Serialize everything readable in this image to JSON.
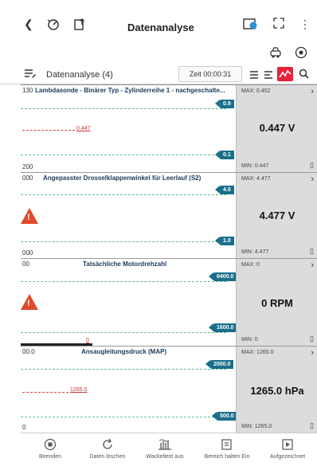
{
  "header": {
    "title": "Datenanalyse",
    "back_icon": "chevron-left-icon",
    "left_icons": [
      "gauge-icon",
      "clipboard-upload-icon"
    ],
    "right_icons": [
      "vci-device-icon",
      "fullscreen-icon",
      "more-vertical-icon"
    ]
  },
  "subbar": {
    "icons": [
      "car-wrench-icon",
      "settings-icon"
    ]
  },
  "toolbar": {
    "section_label": "Datenanalyse (4)",
    "timer": "Zeit 00:00:31",
    "view_icons": [
      "list-icon",
      "lines-icon",
      "graph-icon",
      "search-icon"
    ],
    "accent": "#e8213c"
  },
  "panels": [
    {
      "title": "Lambdasonde - Binärer Typ - Zylinderreihe 1 - nachgeschalte...",
      "y_top": "130",
      "y_bottom": "200",
      "max_marker": "0.9",
      "min_marker": "0.1",
      "trace_label": "0.447",
      "max": "MAX: 0.452",
      "value": "0.447 V",
      "min": "MIN: 0.447",
      "warning": false
    },
    {
      "title": "Angepasster Drosselklappenwinkel für Leerlauf (S2)",
      "y_top": "000",
      "y_bottom": "000",
      "max_marker": "4.0",
      "min_marker": "1.0",
      "trace_label": "",
      "max": "MAX: 4.477",
      "value": "4.477 V",
      "min": "MIN: 4.477",
      "warning": true
    },
    {
      "title": "Tatsächliche Motordrehzahl",
      "y_top": "00",
      "y_bottom": "",
      "max_marker": "6400.0",
      "min_marker": "1600.0",
      "trace_label": "0",
      "max": "MAX: 0",
      "value": "0 RPM",
      "min": "MIN: 0",
      "warning": true
    },
    {
      "title": "Ansaugleitungsdruck (MAP)",
      "y_top": "00.0",
      "y_bottom": "0",
      "max_marker": "2000.0",
      "min_marker": "500.0",
      "trace_label": "1265.0",
      "max": "MAX: 1265.0",
      "value": "1265.0 hPa",
      "min": "MIN: 1265.0",
      "warning": false
    }
  ],
  "bottom_nav": [
    {
      "label": "Beenden",
      "icon": "stop-circle-icon"
    },
    {
      "label": "Daten löschen",
      "icon": "refresh-icon"
    },
    {
      "label": "Wackeltest aus",
      "icon": "vibration-icon"
    },
    {
      "label": "Bereich halten Ein",
      "icon": "hold-range-icon"
    },
    {
      "label": "Aufgezeichnet",
      "icon": "recording-icon"
    }
  ]
}
